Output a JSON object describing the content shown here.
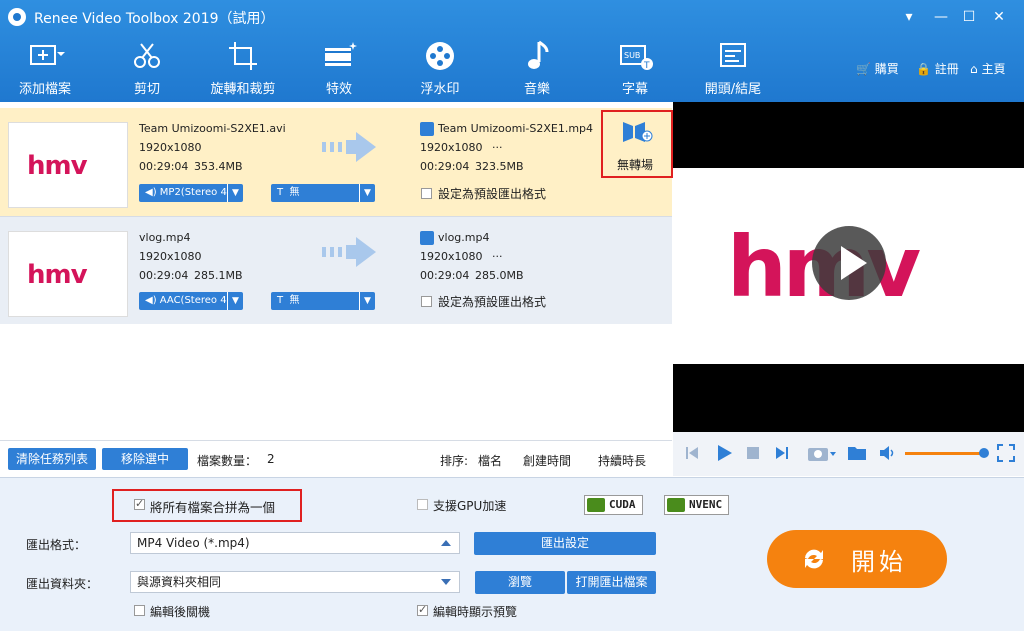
{
  "window": {
    "title": "Renee Video Toolbox 2019（試用）",
    "controls": [
      "▾",
      "—",
      "☐",
      "✕"
    ]
  },
  "toolbar": {
    "items": [
      {
        "label": "添加檔案",
        "icon": "add-file-icon"
      },
      {
        "label": "剪切",
        "icon": "scissors-icon"
      },
      {
        "label": "旋轉和裁剪",
        "icon": "crop-icon"
      },
      {
        "label": "特效",
        "icon": "effects-icon"
      },
      {
        "label": "浮水印",
        "icon": "watermark-icon"
      },
      {
        "label": "音樂",
        "icon": "music-note-icon"
      },
      {
        "label": "字幕",
        "icon": "subtitle-icon"
      },
      {
        "label": "開頭/結尾",
        "icon": "intro-outro-icon"
      }
    ],
    "right_links": [
      {
        "label": "購買",
        "icon": "cart-icon"
      },
      {
        "label": "註冊",
        "icon": "lock-icon"
      },
      {
        "label": "主頁",
        "icon": "home-icon"
      }
    ]
  },
  "files": [
    {
      "thumb_text": "hmv",
      "source_name": "Team Umizoomi-S2XE1.avi",
      "source_res": "1920x1080",
      "source_duration": "00:29:04",
      "source_size": "353.4MB",
      "output_name": "Team Umizoomi-S2XE1.mp4",
      "output_res": "1920x1080",
      "output_dots": "···",
      "output_duration": "00:29:04",
      "output_size": "323.5MB",
      "audio": "MP2(Stereo 4",
      "subtitle_prefix": "T",
      "subtitle": "無",
      "preset_label": "設定為預設匯出格式",
      "transition_label": "無轉場"
    },
    {
      "thumb_text": "hmv",
      "source_name": "vlog.mp4",
      "source_res": "1920x1080",
      "source_duration": "00:29:04",
      "source_size": "285.1MB",
      "output_name": "vlog.mp4",
      "output_res": "1920x1080",
      "output_dots": "···",
      "output_duration": "00:29:04",
      "output_size": "285.0MB",
      "audio": "AAC(Stereo 4",
      "subtitle_prefix": "T",
      "subtitle": "無",
      "preset_label": "設定為預設匯出格式"
    }
  ],
  "preview": {
    "logo_text": "hmv"
  },
  "list_footer": {
    "clear_label": "清除任務列表",
    "remove_label": "移除選中",
    "count_label": "檔案數量：",
    "count_value": "2",
    "sort_label": "排序:",
    "sort_options": [
      "檔名",
      "創建時間",
      "持續時長"
    ]
  },
  "settings": {
    "merge_label": "將所有檔案合拼為一個",
    "merge_checked": true,
    "gpu_label": "支援GPU加速",
    "gpu_checked": false,
    "cuda": "CUDA",
    "nvenc": "NVENC",
    "format_label": "匯出格式：",
    "format_value": "MP4 Video (*.mp4)",
    "export_settings": "匯出設定",
    "folder_label": "匯出資料夾：",
    "folder_value": "與源資料夾相同",
    "browse": "瀏覽",
    "open_folder": "打開匯出檔案",
    "shutdown_label": "編輯後關機",
    "shutdown_checked": false,
    "show_preview_label": "編輯時顯示預覽",
    "show_preview_checked": true
  },
  "start": {
    "label": "開始"
  },
  "colors": {
    "accent": "#1f78cf",
    "start": "#f5820f",
    "highlight_row": "#fff0c6",
    "hmv": "#d4145a"
  }
}
